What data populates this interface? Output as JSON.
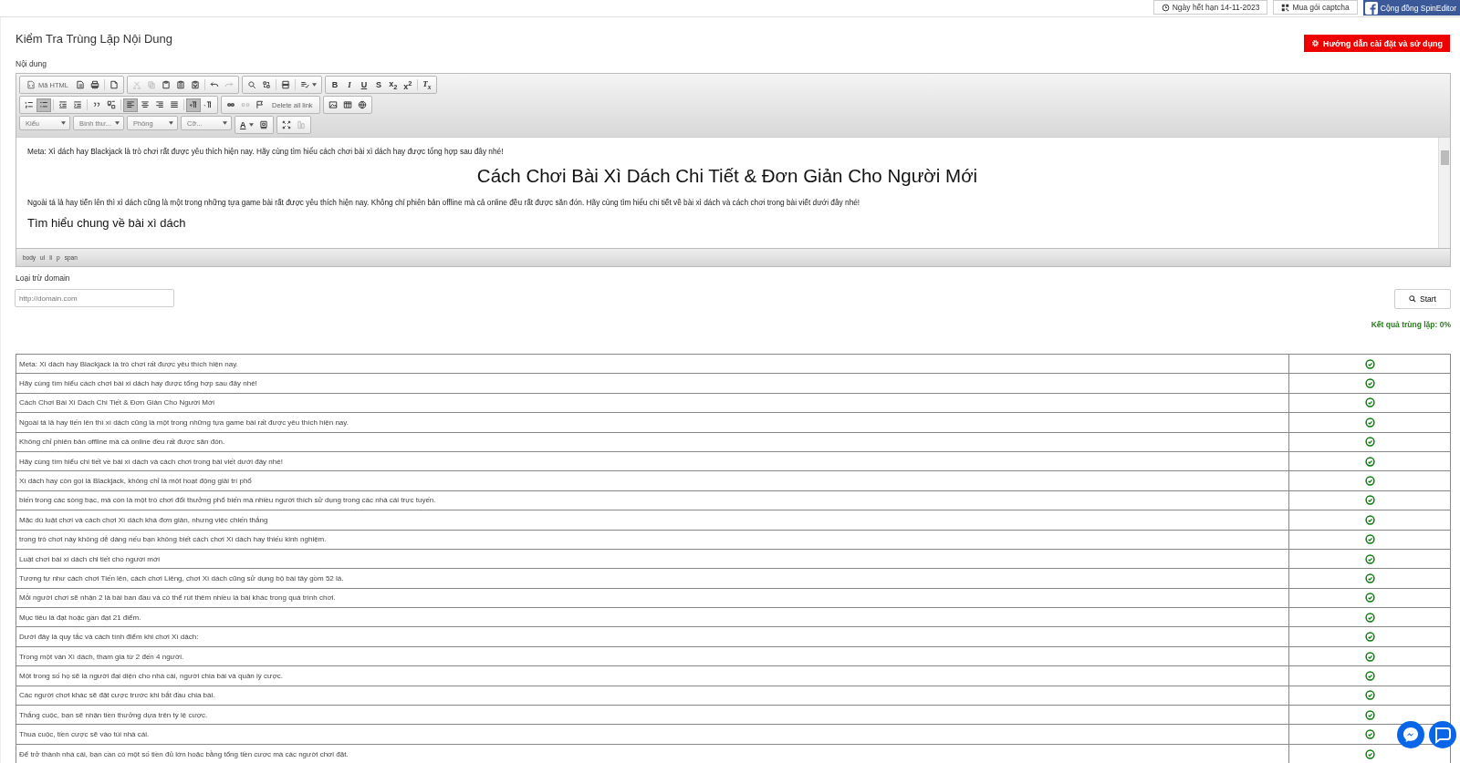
{
  "topbar": {
    "expiry": "Ngày hết hạn 14-11-2023",
    "captcha": "Mua gói captcha",
    "community": "Cộng đồng SpinEditor"
  },
  "page": {
    "title": "Kiểm Tra Trùng Lặp Nội Dung",
    "help_button": "Hướng dẫn cài đặt và sử dụng",
    "content_label": "Nội dung"
  },
  "toolbar": {
    "rows": [
      {
        "groups": [
          {
            "items": [
              {
                "kind": "icontext",
                "label": "Mã HTML"
              },
              {
                "kind": "icon",
                "selected": false,
                "disabled": false
              },
              {
                "kind": "icon",
                "selected": false,
                "disabled": false
              },
              {
                "kind": "sep"
              },
              {
                "kind": "icon",
                "selected": false,
                "disabled": false
              }
            ]
          },
          {
            "items": [
              {
                "kind": "icon",
                "selected": false,
                "disabled": true
              },
              {
                "kind": "icon",
                "selected": false,
                "disabled": true
              },
              {
                "kind": "icon",
                "selected": false,
                "disabled": false
              },
              {
                "kind": "icon",
                "selected": false,
                "disabled": false
              },
              {
                "kind": "icon",
                "selected": false,
                "disabled": false
              },
              {
                "kind": "sep"
              },
              {
                "kind": "icon",
                "selected": false,
                "disabled": false
              },
              {
                "kind": "icon",
                "selected": false,
                "disabled": true
              }
            ]
          },
          {
            "items": [
              {
                "kind": "icon",
                "selected": false,
                "disabled": false
              },
              {
                "kind": "icon",
                "selected": false,
                "disabled": false
              },
              {
                "kind": "sep"
              },
              {
                "kind": "icon",
                "selected": false,
                "disabled": false
              },
              {
                "kind": "sep"
              },
              {
                "kind": "menu"
              }
            ]
          },
          {
            "items": [
              {
                "kind": "glyph",
                "label": "B"
              },
              {
                "kind": "glyph",
                "label": "I"
              },
              {
                "kind": "glyph",
                "label": "U"
              },
              {
                "kind": "glyph",
                "label": "S"
              },
              {
                "kind": "glyph",
                "label": "x$_{2}$"
              },
              {
                "kind": "glyph",
                "label": "x$^{2}$"
              },
              {
                "kind": "sep"
              },
              {
                "kind": "glyph",
                "label": "T$_{x}$"
              }
            ]
          }
        ]
      },
      {
        "groups": [
          {
            "items": [
              {
                "kind": "icon",
                "selected": false,
                "disabled": false
              },
              {
                "kind": "icon",
                "selected": true,
                "disabled": false
              },
              {
                "kind": "sep"
              },
              {
                "kind": "icon",
                "selected": false,
                "disabled": false
              },
              {
                "kind": "icon",
                "selected": false,
                "disabled": false
              },
              {
                "kind": "sep"
              },
              {
                "kind": "icon",
                "selected": false,
                "disabled": false
              },
              {
                "kind": "icon",
                "selected": false,
                "disabled": false
              },
              {
                "kind": "sep"
              },
              {
                "kind": "icon",
                "selected": true,
                "disabled": false
              },
              {
                "kind": "icon",
                "selected": false,
                "disabled": false
              },
              {
                "kind": "icon",
                "selected": false,
                "disabled": false
              },
              {
                "kind": "icon",
                "selected": false,
                "disabled": false
              },
              {
                "kind": "sep"
              },
              {
                "kind": "icon",
                "selected": true,
                "disabled": false
              },
              {
                "kind": "icon",
                "selected": false,
                "disabled": false
              }
            ]
          },
          {
            "items": [
              {
                "kind": "icon",
                "selected": false,
                "disabled": false
              },
              {
                "kind": "icon",
                "selected": false,
                "disabled": true
              },
              {
                "kind": "icon",
                "selected": false,
                "disabled": false
              },
              {
                "kind": "text",
                "label": "Delete all link"
              }
            ]
          },
          {
            "items": [
              {
                "kind": "icon",
                "selected": false,
                "disabled": false
              },
              {
                "kind": "icon",
                "selected": false,
                "disabled": false
              },
              {
                "kind": "icon",
                "selected": false,
                "disabled": false
              }
            ]
          }
        ]
      },
      {
        "groups": [
          {
            "items": [
              {
                "kind": "select",
                "label": "Kiểu"
              }
            ]
          },
          {
            "items": [
              {
                "kind": "select",
                "label": "Bình thư..."
              }
            ]
          },
          {
            "items": [
              {
                "kind": "select",
                "label": "Phông"
              }
            ]
          },
          {
            "items": [
              {
                "kind": "select",
                "label": "Cỡ..."
              }
            ]
          },
          {
            "items": [
              {
                "kind": "glyph",
                "label": "A"
              },
              {
                "kind": "icon",
                "selected": false,
                "disabled": false
              }
            ]
          },
          {
            "items": [
              {
                "kind": "icon",
                "selected": false,
                "disabled": false
              },
              {
                "kind": "icon",
                "selected": false,
                "disabled": true
              }
            ]
          }
        ]
      }
    ]
  },
  "editor": {
    "blocks": [
      {
        "kind": "p",
        "text": "Meta: Xì dách hay Blackjack là trò chơi rất được yêu thích hiện nay. Hãy cùng tìm hiểu cách chơi bài xì dách hay được tổng hợp sau đây nhé!"
      },
      {
        "kind": "h1",
        "text": "Cách Chơi Bài Xì Dách Chi Tiết & Đơn Giản Cho Người Mới"
      },
      {
        "kind": "p",
        "text": "Ngoài tá lả hay tiến lên thì xì dách cũng là một trong những tựa game bài rất được yêu thích hiện nay. Không chỉ phiên bản offline mà cả online đều rất được săn đón. Hãy cùng tìm hiểu chi tiết về bài xì dách và cách chơi trong bài viết dưới đây nhé!"
      },
      {
        "kind": "h2",
        "text": "Tìm hiểu chung về bài xì dách"
      }
    ],
    "path": [
      "body",
      "ul",
      "li",
      "p",
      "span"
    ]
  },
  "exclude": {
    "label": "Loại trừ domain",
    "placeholder": "http://domain.com"
  },
  "start_button": "Start",
  "result": "Kết quả trùng lặp: 0%",
  "rows": [
    {
      "text": "Meta: Xì dách hay Blackjack là trò chơi rất được yêu thích hiện nay.",
      "duplicate": false
    },
    {
      "text": "Hãy cùng tìm hiểu cách chơi bài xì dách hay được tổng hợp sau đây nhé!",
      "duplicate": false
    },
    {
      "text": "Cách Chơi Bài Xì Dách Chi Tiết & Đơn Giản Cho Người Mới",
      "duplicate": false
    },
    {
      "text": "Ngoài tá lả hay tiến lên thì xì dách cũng là một trong những tựa game bài rất được yêu thích hiện nay.",
      "duplicate": false
    },
    {
      "text": "Không chỉ phiên bản offline mà cả online đều rất được săn đón.",
      "duplicate": false
    },
    {
      "text": "Hãy cùng tìm hiểu chi tiết về bài xì dách và cách chơi trong bài viết dưới đây nhé!",
      "duplicate": false
    },
    {
      "text": "Xì dách hay còn gọi là Blackjack, không chỉ là một hoạt động giải trí phổ",
      "duplicate": false
    },
    {
      "text": "biến trong các sòng bạc, mà còn là một trò chơi đổi thưởng phổ biến mà nhiều người thích sử dụng trong các nhà cái trực tuyến.",
      "duplicate": false
    },
    {
      "text": "Mặc dù luật chơi và cách chơi Xì dách khá đơn giản, nhưng việc chiến thắng",
      "duplicate": false
    },
    {
      "text": "trong trò chơi này không dễ dàng nếu bạn không biết cách chơi Xì dách hay thiếu kinh nghiệm.",
      "duplicate": false
    },
    {
      "text": "Luật chơi bài xì dách chi tiết cho người mới",
      "duplicate": false
    },
    {
      "text": "Tương tự như cách chơi Tiến lên, cách chơi Liêng, chơi Xì dách cũng sử dụng bộ bài tây gồm 52 lá.",
      "duplicate": false
    },
    {
      "text": "Mỗi người chơi sẽ nhận 2 lá bài ban đầu và có thể rút thêm nhiều lá bài khác trong quá trình chơi.",
      "duplicate": false
    },
    {
      "text": "Mục tiêu là đạt hoặc gần đạt 21 điểm.",
      "duplicate": false
    },
    {
      "text": "Dưới đây là quy tắc và cách tính điểm khi chơi Xì dách:",
      "duplicate": false
    },
    {
      "text": "Trong một ván Xì dách, tham gia từ 2 đến 4 người.",
      "duplicate": false
    },
    {
      "text": "Một trong số họ sẽ là người đại diện cho nhà cái, người chia bài và quản lý cược.",
      "duplicate": false
    },
    {
      "text": "Các người chơi khác sẽ đặt cược trước khi bắt đầu chia bài.",
      "duplicate": false
    },
    {
      "text": "Thắng cuộc, bạn sẽ nhận tiền thưởng dựa trên tỷ lệ cược.",
      "duplicate": false
    },
    {
      "text": "Thua cuộc, tiền cược sẽ vào túi nhà cái.",
      "duplicate": false
    },
    {
      "text": "Để trở thành nhà cái, bạn cần có một số tiền đủ lớn hoặc bằng tổng tiền cược mà các người chơi đặt.",
      "duplicate": false
    }
  ]
}
